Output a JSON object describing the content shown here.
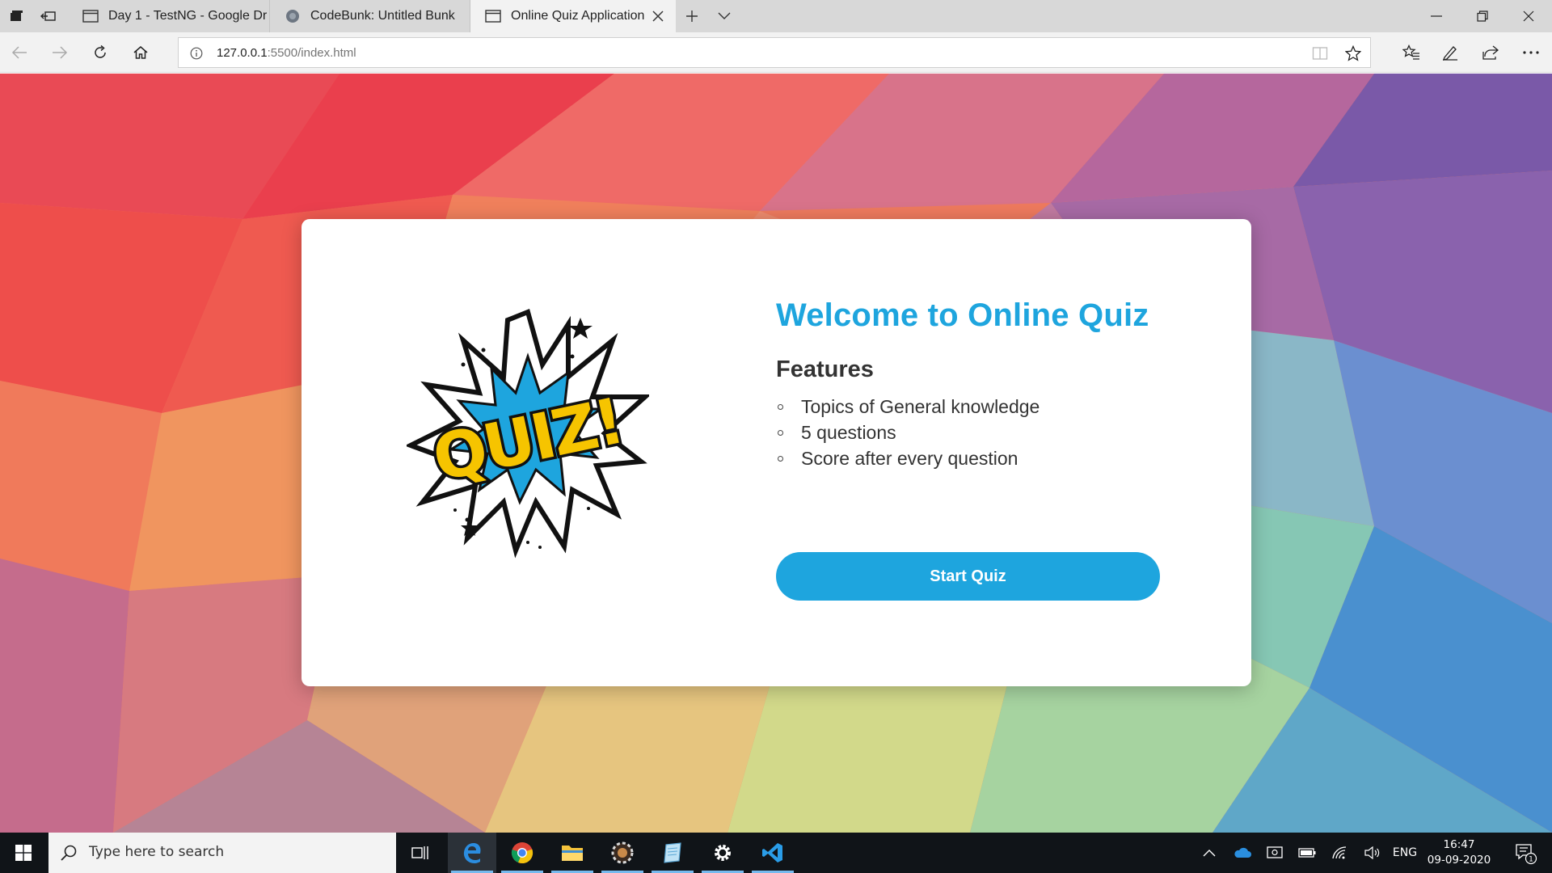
{
  "browser": {
    "tabs": [
      {
        "title": "Day 1 - TestNG - Google Dr",
        "icon": "page-icon",
        "active": false
      },
      {
        "title": "CodeBunk: Untitled Bunk",
        "icon": "codebunk-favicon",
        "active": false
      },
      {
        "title": "Online Quiz Application",
        "icon": "page-icon",
        "active": true
      }
    ],
    "address": {
      "host": "127.0.0.1",
      "path": ":5500/index.html"
    }
  },
  "page": {
    "logo_text": "QUIZ!",
    "heading": "Welcome to Online Quiz",
    "features_title": "Features",
    "features": [
      "Topics of General knowledge",
      "5 questions",
      "Score after every question"
    ],
    "start_button": "Start Quiz",
    "accent_color": "#1ea5de"
  },
  "taskbar": {
    "search_placeholder": "Type here to search",
    "language": "ENG",
    "time": "16:47",
    "date": "09-09-2020",
    "notification_count": "1"
  }
}
